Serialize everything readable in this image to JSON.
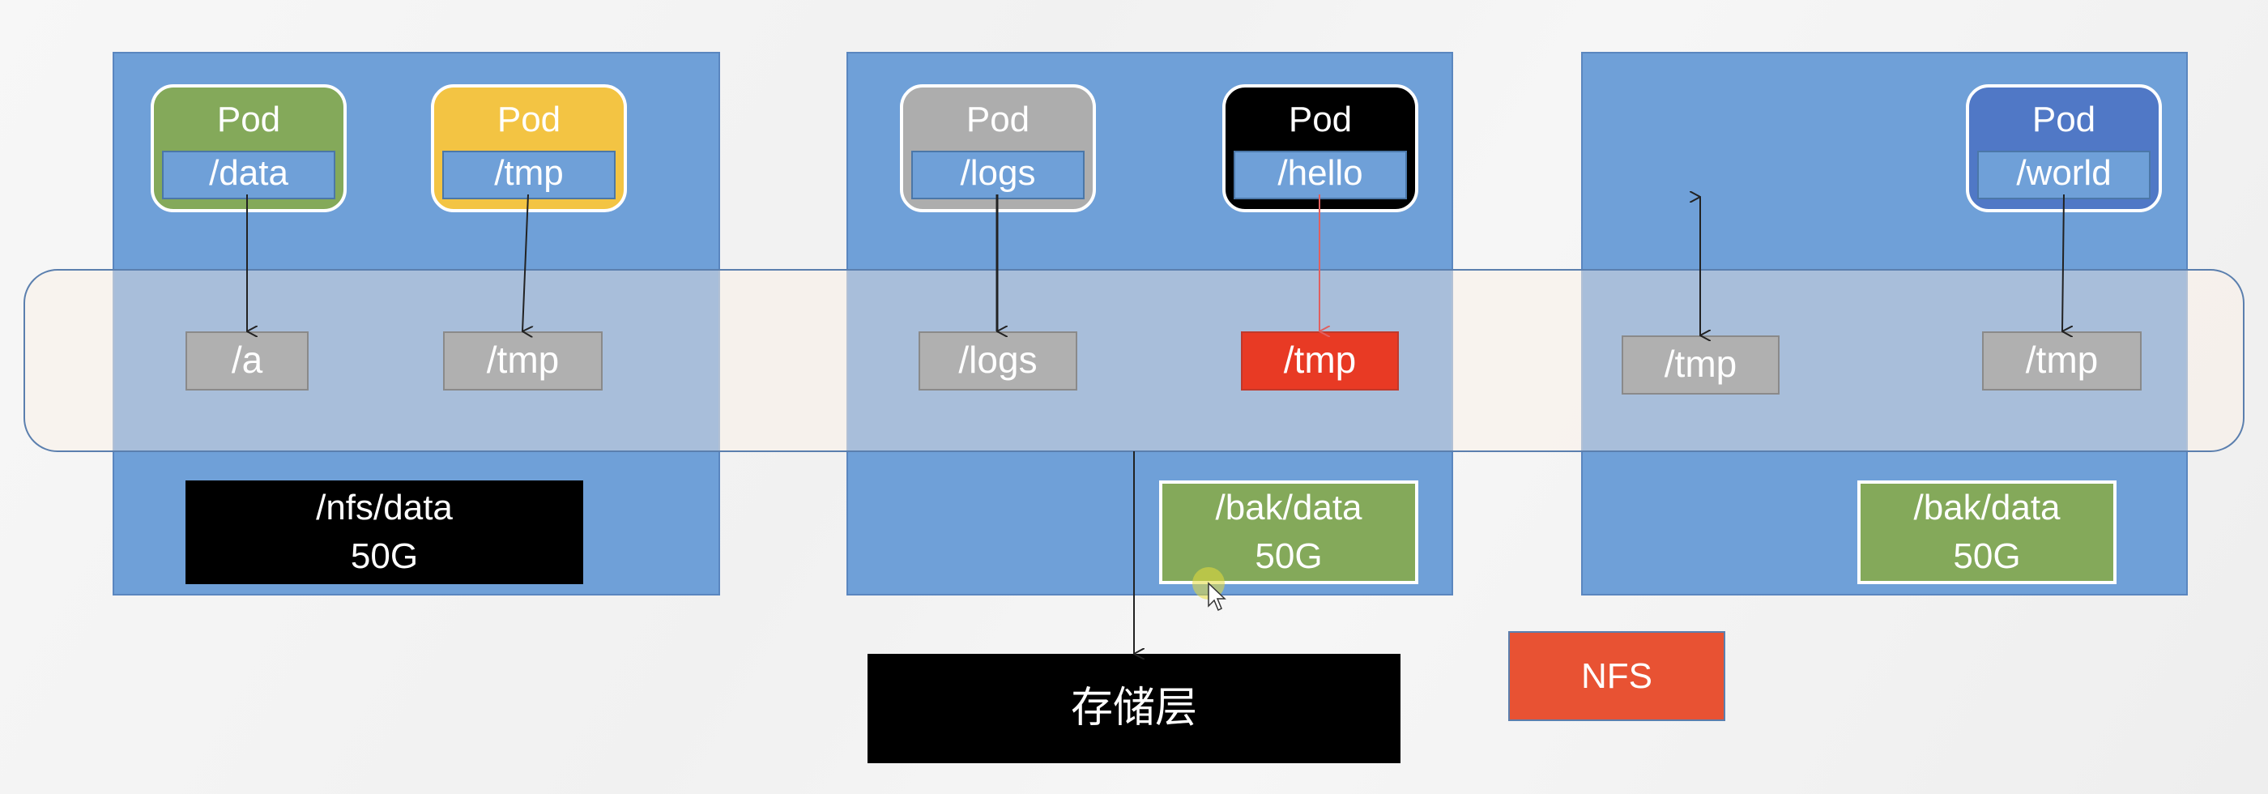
{
  "nodes": [
    {
      "pods": [
        {
          "title": "Pod",
          "mount": "/data",
          "color": "#84a95a"
        },
        {
          "title": "Pod",
          "mount": "/tmp",
          "color": "#f3c443"
        }
      ],
      "volumes": [
        "/a",
        "/tmp"
      ],
      "storage": {
        "path": "/nfs/data",
        "size": "50G",
        "color": "#000000"
      }
    },
    {
      "pods": [
        {
          "title": "Pod",
          "mount": "/logs",
          "color": "#adadad"
        },
        {
          "title": "Pod",
          "mount": "/hello",
          "color": "#000000"
        }
      ],
      "volumes": [
        "/logs",
        "/tmp"
      ],
      "storage": {
        "path": "/bak/data",
        "size": "50G",
        "color": "#84a95a"
      }
    },
    {
      "pods": [
        {
          "title": "Pod",
          "mount": "/world",
          "color": "#5078c6"
        }
      ],
      "volumes": [
        "/tmp",
        "/tmp"
      ],
      "storage": {
        "path": "/bak/data",
        "size": "50G",
        "color": "#84a95a"
      }
    }
  ],
  "storage_layer": {
    "label": "存储层"
  },
  "nfs": {
    "label": "NFS",
    "color": "#e85233"
  },
  "colors": {
    "node": "#6fa0d8",
    "volume_highlight": "#e83a24",
    "arrow_highlight": "#e06060"
  }
}
